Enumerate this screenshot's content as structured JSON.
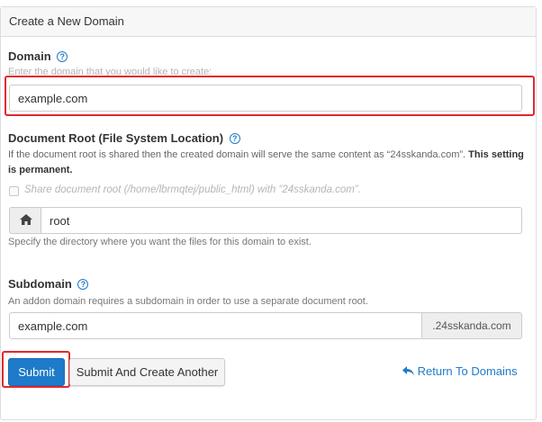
{
  "panel": {
    "title": "Create a New Domain"
  },
  "domain": {
    "label": "Domain",
    "hint": "Enter the domain that you would like to create:",
    "value": "example.com"
  },
  "docroot": {
    "label": "Document Root (File System Location)",
    "description": "If the document root is shared then the created domain will serve the same content as “24sskanda.com”.",
    "description_bold": "This setting is permanent.",
    "share_checkbox_label": "Share document root (/home/lbrmqtej/public_html) with “24sskanda.com”.",
    "share_checked": false,
    "value": "root",
    "help": "Specify the directory where you want the files for this domain to exist."
  },
  "subdomain": {
    "label": "Subdomain",
    "description": "An addon domain requires a subdomain in order to use a separate document root.",
    "value": "example.com",
    "suffix": ".24sskanda.com"
  },
  "actions": {
    "submit_label": "Submit",
    "submit_another_label": "Submit And Create Another",
    "return_label": "Return To Domains"
  },
  "colors": {
    "accent": "#1e7bc9",
    "highlight": "#e0282e"
  },
  "icons": {
    "help": "question-circle-icon",
    "home": "home-icon",
    "return": "reply-arrow-icon"
  }
}
